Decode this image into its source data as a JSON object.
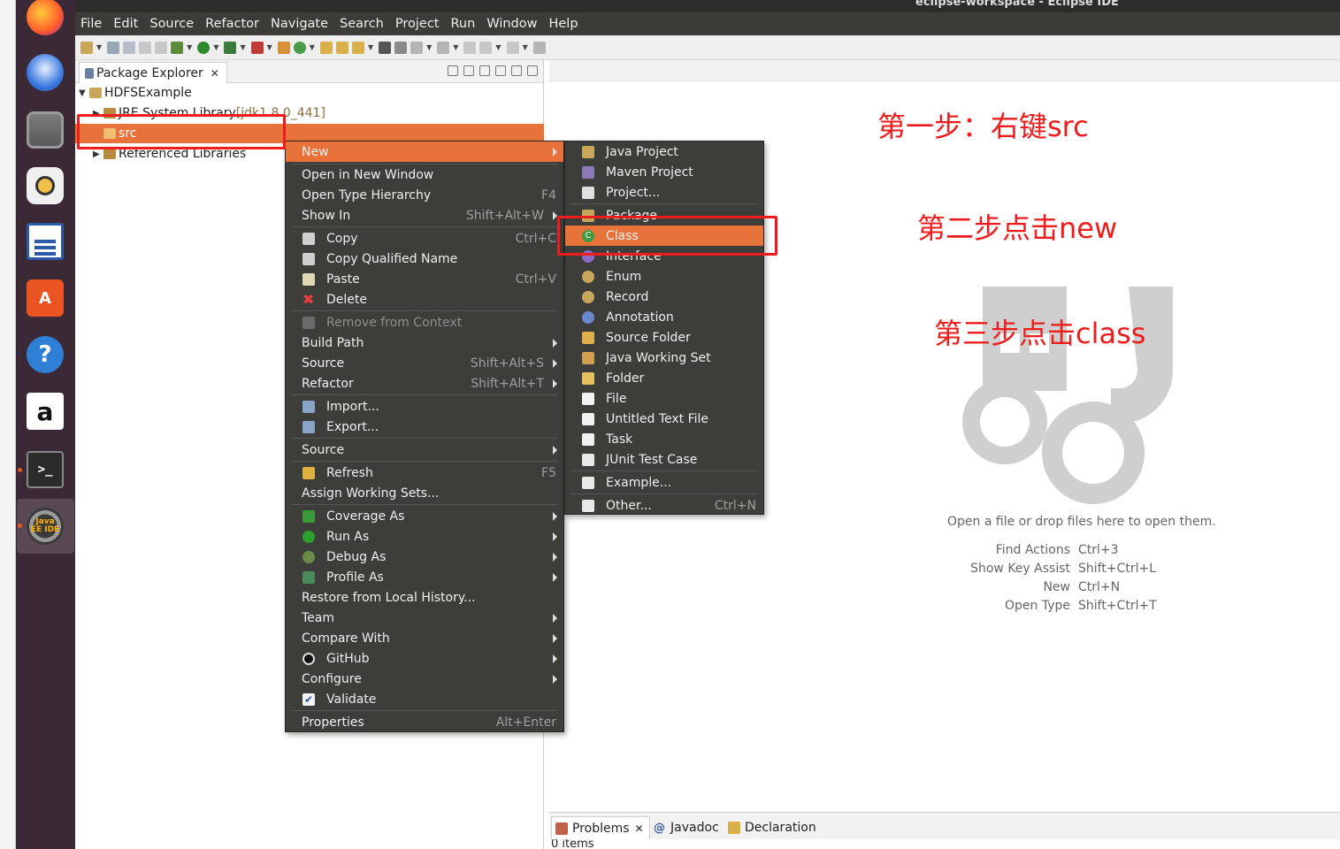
{
  "window": {
    "title": "eclipse-workspace - Eclipse IDE"
  },
  "menubar": [
    "File",
    "Edit",
    "Source",
    "Refactor",
    "Navigate",
    "Search",
    "Project",
    "Run",
    "Window",
    "Help"
  ],
  "dock": {
    "items": [
      "firefox-icon",
      "thunderbird-icon",
      "files-icon",
      "rhythmbox-icon",
      "writer-icon",
      "software-icon",
      "help-icon",
      "amazon-icon",
      "terminal-icon",
      "eclipse-icon"
    ],
    "eclipse_label": "Java EE IDE",
    "amazon_label": "a",
    "help_label": "?",
    "terminal_label": ">_"
  },
  "package_explorer": {
    "tab_label": "Package Explorer",
    "close": "✕",
    "tree": {
      "project": "HDFSExample",
      "jre_label": "JRE System Library",
      "jre_detail": "[jdk1.8.0_441]",
      "src": "src",
      "referenced": "Referenced Libraries"
    }
  },
  "context_menu": {
    "items": [
      {
        "label": "New",
        "submenu": true,
        "highlighted": true
      },
      {
        "label": "Open in New Window"
      },
      {
        "label": "Open Type Hierarchy",
        "shortcut": "F4"
      },
      {
        "label": "Show In",
        "shortcut": "Shift+Alt+W",
        "submenu": true
      },
      {
        "label": "Copy",
        "shortcut": "Ctrl+C"
      },
      {
        "label": "Copy Qualified Name"
      },
      {
        "label": "Paste",
        "shortcut": "Ctrl+V"
      },
      {
        "label": "Delete"
      },
      {
        "label": "Remove from Context",
        "disabled": true
      },
      {
        "label": "Build Path",
        "submenu": true
      },
      {
        "label": "Source",
        "shortcut": "Shift+Alt+S",
        "submenu": true
      },
      {
        "label": "Refactor",
        "shortcut": "Shift+Alt+T",
        "submenu": true
      },
      {
        "label": "Import..."
      },
      {
        "label": "Export..."
      },
      {
        "label": "Source",
        "submenu": true
      },
      {
        "label": "Refresh",
        "shortcut": "F5"
      },
      {
        "label": "Assign Working Sets..."
      },
      {
        "label": "Coverage As",
        "submenu": true
      },
      {
        "label": "Run As",
        "submenu": true
      },
      {
        "label": "Debug As",
        "submenu": true
      },
      {
        "label": "Profile As",
        "submenu": true
      },
      {
        "label": "Restore from Local History..."
      },
      {
        "label": "Team",
        "submenu": true
      },
      {
        "label": "Compare With",
        "submenu": true
      },
      {
        "label": "GitHub",
        "submenu": true
      },
      {
        "label": "Configure",
        "submenu": true
      },
      {
        "label": "Validate"
      },
      {
        "label": "Properties",
        "shortcut": "Alt+Enter"
      }
    ]
  },
  "new_submenu": {
    "items": [
      {
        "label": "Java Project"
      },
      {
        "label": "Maven Project"
      },
      {
        "label": "Project..."
      },
      {
        "label": "Package"
      },
      {
        "label": "Class",
        "highlighted": true
      },
      {
        "label": "Interface"
      },
      {
        "label": "Enum"
      },
      {
        "label": "Record"
      },
      {
        "label": "Annotation"
      },
      {
        "label": "Source Folder"
      },
      {
        "label": "Java Working Set"
      },
      {
        "label": "Folder"
      },
      {
        "label": "File"
      },
      {
        "label": "Untitled Text File"
      },
      {
        "label": "Task"
      },
      {
        "label": "JUnit Test Case"
      },
      {
        "label": "Example..."
      },
      {
        "label": "Other...",
        "shortcut": "Ctrl+N"
      }
    ]
  },
  "editor": {
    "open_hint": "Open a file or drop files here to open them.",
    "shortcuts": [
      {
        "action": "Find Actions",
        "key": "Ctrl+3"
      },
      {
        "action": "Show Key Assist",
        "key": "Shift+Ctrl+L"
      },
      {
        "action": "New",
        "key": "Ctrl+N"
      },
      {
        "action": "Open Type",
        "key": "Shift+Ctrl+T"
      }
    ]
  },
  "bottom_panel": {
    "tabs": [
      "Problems",
      "Javadoc",
      "Declaration"
    ],
    "close": "✕",
    "javadoc_icon": "@",
    "status": "0 items"
  },
  "annotations": {
    "step1": "第一步：右键src",
    "step2": "第二步点击new",
    "step3": "第三步点击class"
  },
  "colors": {
    "highlight": "#e8733a",
    "menu_bg": "#3d3d3a",
    "dock_bg": "#3b2a35",
    "annotation_red": "#ee1c1c"
  }
}
